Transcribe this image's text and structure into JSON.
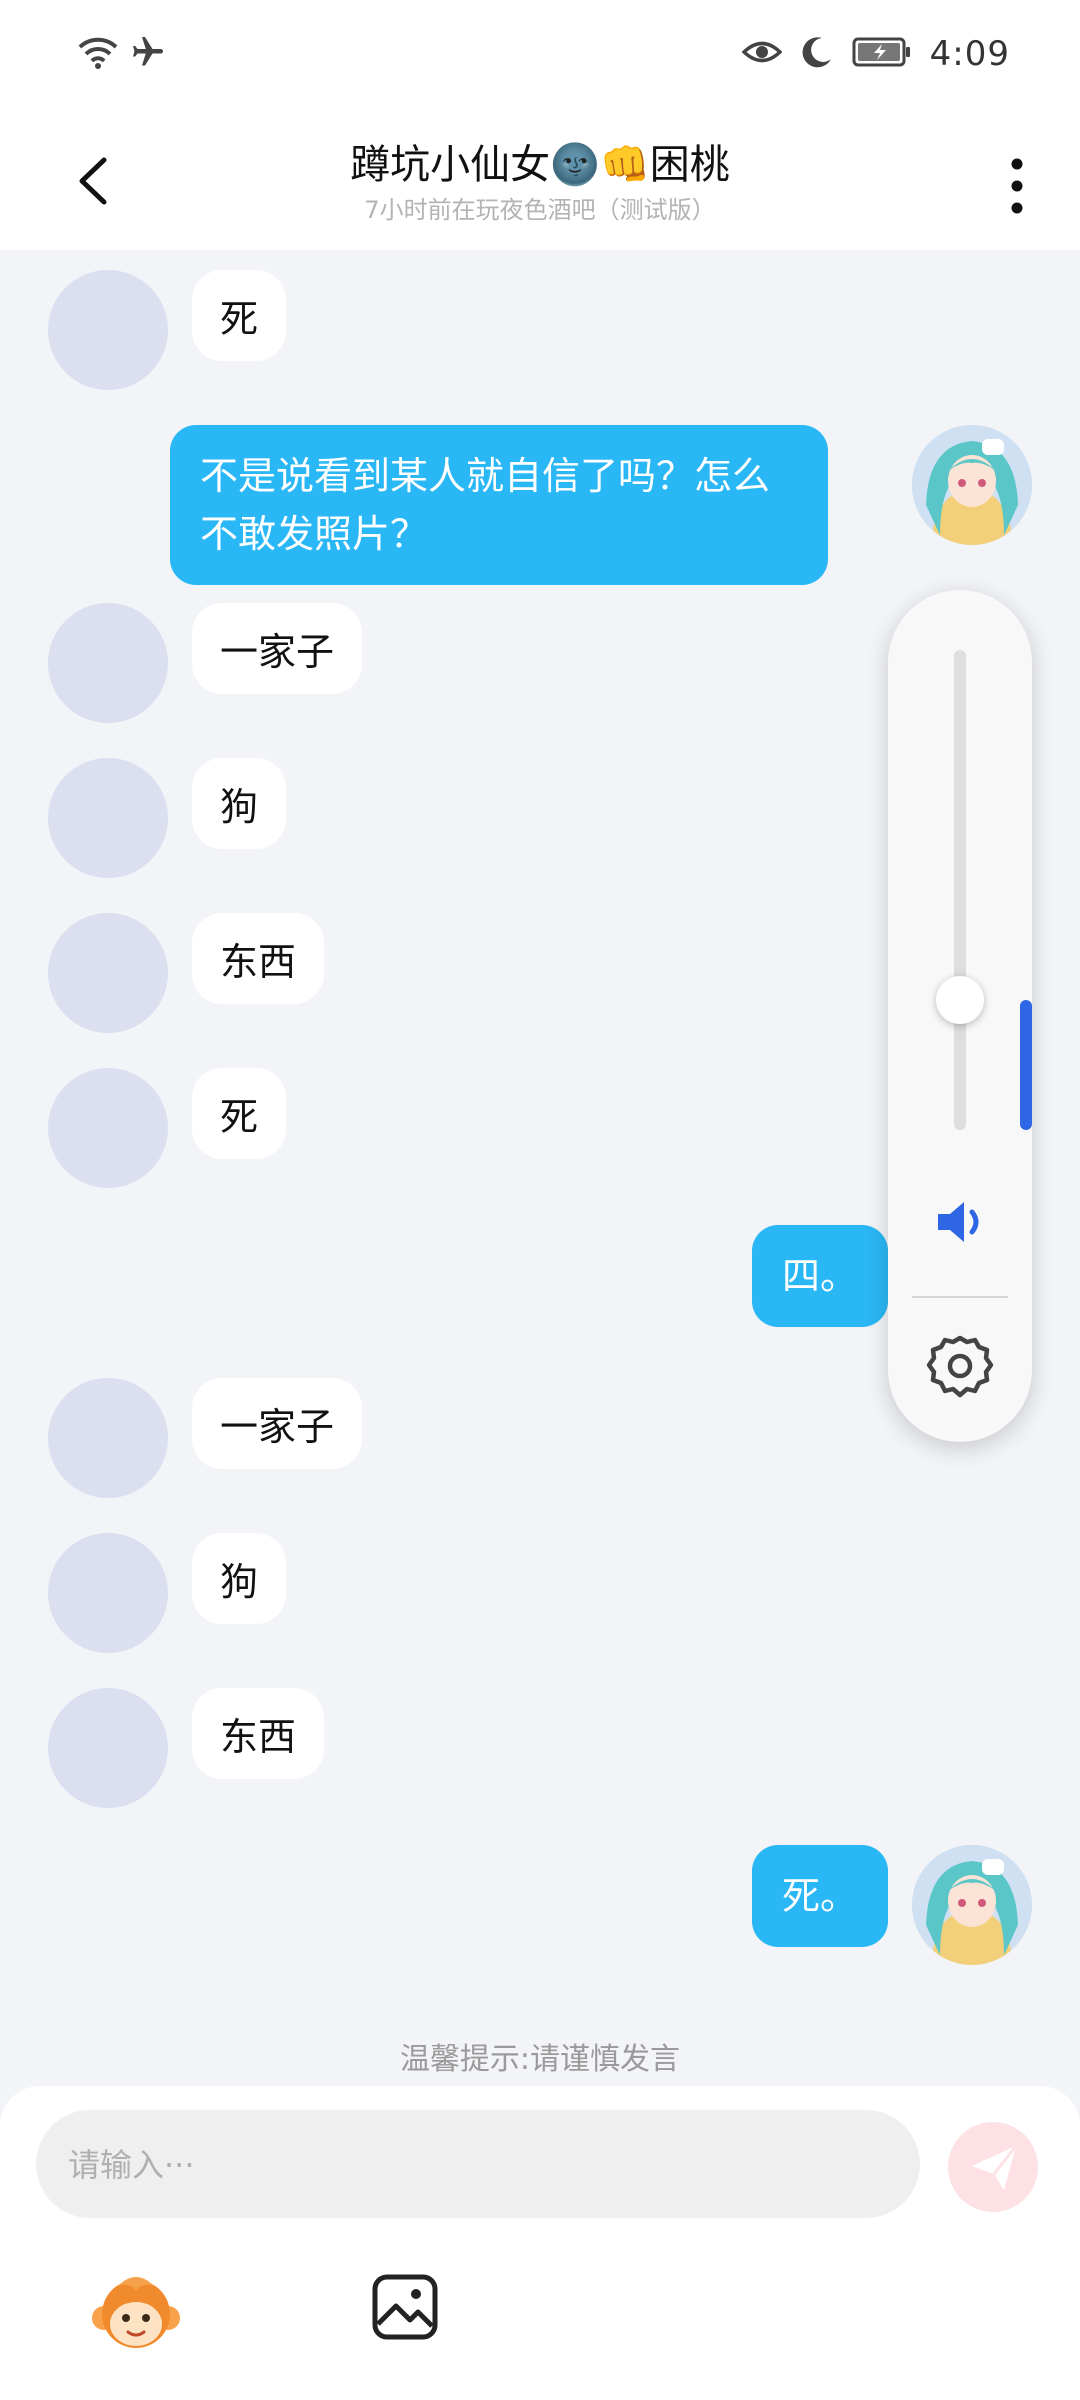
{
  "status_bar": {
    "time": "4:09",
    "icons": [
      "wifi-icon",
      "airplane-icon",
      "eye-icon",
      "moon-icon",
      "battery-charging-icon"
    ]
  },
  "header": {
    "title": "蹲坑小仙女🌚👊困桃",
    "subtitle": "7小时前在玩夜色酒吧（测试版）",
    "back_icon": "chevron-left-icon",
    "more_icon": "more-vertical-icon"
  },
  "messages": [
    {
      "side": "in",
      "text": "死"
    },
    {
      "side": "out",
      "text": "不是说看到某人就自信了吗？怎么不敢发照片？"
    },
    {
      "side": "in",
      "text": "一家子"
    },
    {
      "side": "in",
      "text": "狗"
    },
    {
      "side": "in",
      "text": "东西"
    },
    {
      "side": "in",
      "text": "死"
    },
    {
      "side": "out",
      "text": "四。"
    },
    {
      "side": "in",
      "text": "一家子"
    },
    {
      "side": "in",
      "text": "狗"
    },
    {
      "side": "in",
      "text": "东西"
    },
    {
      "side": "out",
      "text": "死。"
    }
  ],
  "volume_panel": {
    "level_fraction": 0.27,
    "speaker_icon": "speaker-icon",
    "settings_icon": "gear-icon",
    "accent": "#2f66e6"
  },
  "tip": "温馨提示:请谨慎发言",
  "composer": {
    "placeholder": "请输入···",
    "send_icon": "send-icon",
    "mascot_icon": "monkey-mascot-icon",
    "image_icon": "image-icon"
  },
  "colors": {
    "outgoing_bubble": "#2ab7f5",
    "incoming_bubble": "#ffffff",
    "background": "#f2f4f8",
    "avatar_placeholder": "#dcdfef"
  }
}
